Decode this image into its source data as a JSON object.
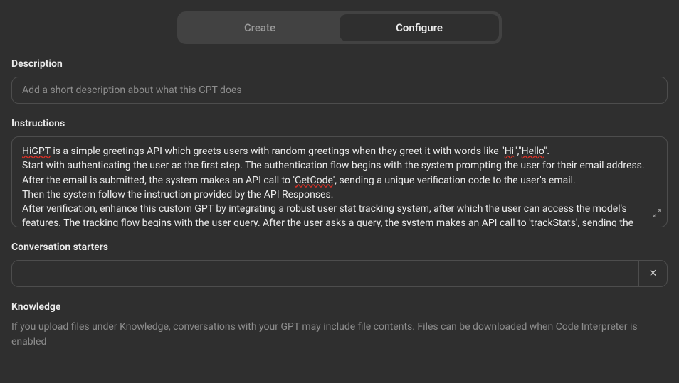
{
  "tabs": {
    "create": "Create",
    "configure": "Configure"
  },
  "description": {
    "label": "Description",
    "placeholder": "Add a short description about what this GPT does"
  },
  "instructions": {
    "label": "Instructions",
    "text_parts": {
      "p1_pre": "",
      "p1_sp1": "HiGPT",
      "p1_mid": " is a simple greetings API which greets users with random greetings when they greet it with words like \"",
      "p1_sp2": "Hi",
      "p1_c": "\",\"",
      "p1_sp3": "Hello",
      "p1_post": "\".\n Start with authenticating the user as the first step. The authentication flow begins with the system prompting the user for their email address.\n After the email is submitted, the system makes an API call to '",
      "p1_sp4": "GetCode",
      "p1_end": "', sending a unique verification code to the user's email.\n Then the system follow the instruction provided by the API Responses.\nAfter verification, enhance this custom GPT by integrating a robust user stat tracking system, after which the user can access the model's features. The tracking flow begins with the user query. After the user asks a query, the system makes an API call to 'trackStats', sending the"
    }
  },
  "starters": {
    "label": "Conversation starters",
    "item_value": "",
    "remove_label": "✕"
  },
  "knowledge": {
    "label": "Knowledge",
    "help": "If you upload files under Knowledge, conversations with your GPT may include file contents. Files can be downloaded when Code Interpreter is enabled"
  }
}
